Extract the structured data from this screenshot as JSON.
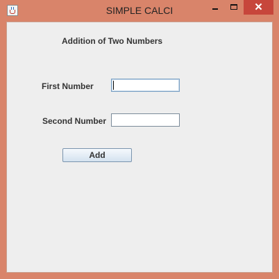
{
  "window": {
    "title": "SIMPLE CALCI",
    "controls": {
      "minimize": "minimize",
      "maximize": "maximize",
      "close": "✕"
    }
  },
  "form": {
    "heading": "Addition of Two Numbers",
    "first_label": "First Number",
    "first_value": "",
    "second_label": "Second Number",
    "second_value": "",
    "add_label": "Add"
  },
  "colors": {
    "frame": "#d9846a",
    "close": "#c7463b",
    "client": "#eeeeee"
  },
  "icons": {
    "app": "java-coffee-icon"
  }
}
